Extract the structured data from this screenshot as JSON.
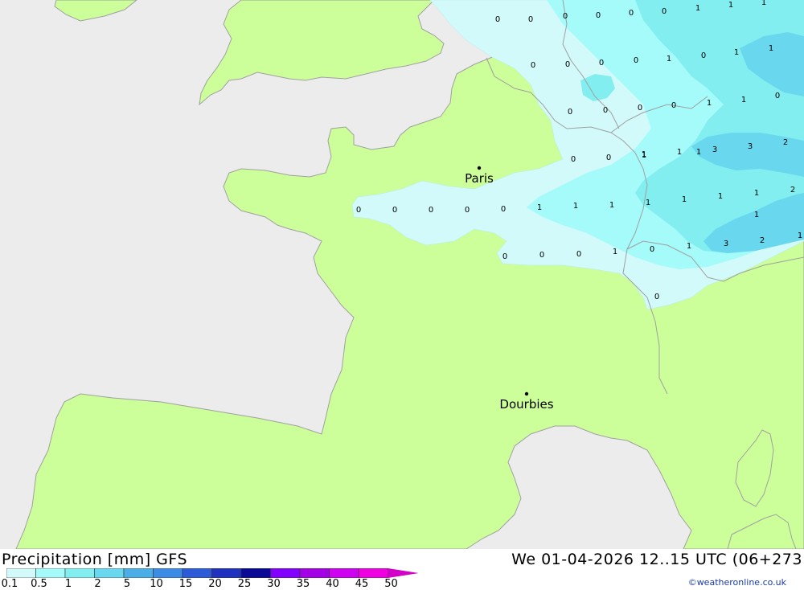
{
  "map": {
    "colors": {
      "sea": "#ececec",
      "land": "#ccff99",
      "border": "#a0a0a0"
    },
    "cities": [
      {
        "name": "Paris"
      },
      {
        "name": "Dourbies"
      }
    ],
    "values": [
      "0",
      "0",
      "0",
      "0",
      "0",
      "0",
      "1",
      "1",
      "1",
      "0",
      "0",
      "0",
      "1",
      "0",
      "1",
      "1",
      "0",
      "0",
      "0",
      "0",
      "0",
      "1",
      "1",
      "0",
      "0",
      "0",
      "1",
      "3",
      "3",
      "2",
      "1",
      "1",
      "1",
      "1",
      "2",
      "0",
      "0",
      "0",
      "0",
      "0",
      "1",
      "1",
      "1",
      "1",
      "1",
      "1",
      "1",
      "0",
      "0",
      "0",
      "1",
      "0",
      "1",
      "3",
      "2",
      "1",
      "0"
    ]
  },
  "footer": {
    "title": "Precipitation [mm] GFS",
    "datetime": "We 01-04-2026 12..15 UTC (06+273",
    "credit": "©weatheronline.co.uk"
  },
  "legend": {
    "colors": [
      "#d2fafa",
      "#a5fafa",
      "#82eef0",
      "#69d7ee",
      "#4baee6",
      "#3c8ce6",
      "#2d5ad7",
      "#1e32be",
      "#0a0a96",
      "#8200ff",
      "#a400e6",
      "#cd00f0",
      "#ef00e1",
      "#d200c8"
    ],
    "labels": [
      "0.1",
      "0.5",
      "1",
      "2",
      "5",
      "10",
      "15",
      "20",
      "25",
      "30",
      "35",
      "40",
      "45",
      "50"
    ]
  }
}
